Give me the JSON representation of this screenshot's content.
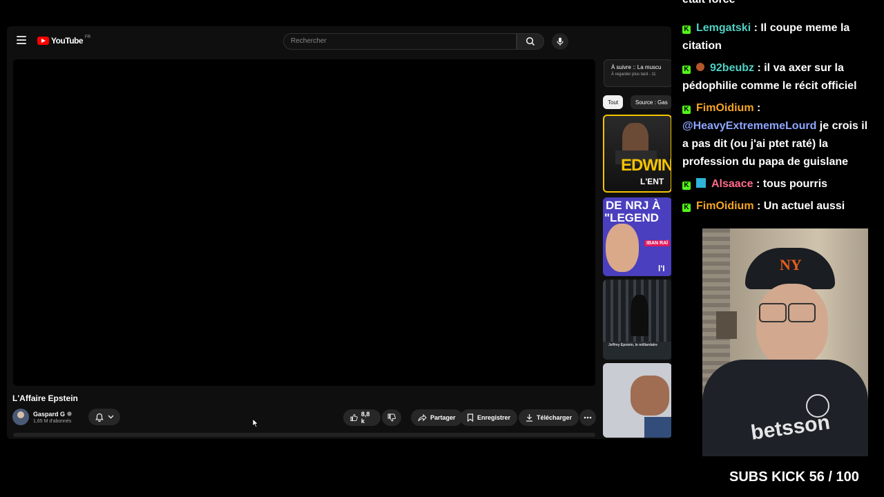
{
  "youtube": {
    "logo_text": "YouTube",
    "country_code": "FR",
    "search_placeholder": "Rechercher",
    "video_title": "L'Affaire Epstein",
    "channel_name": "Gaspard G",
    "channel_subs": "1,65 M d'abonnés",
    "likes": "8,8 k",
    "share_label": "Partager",
    "save_label": "Enregistrer",
    "download_label": "Télécharger",
    "up_next_title": "À suivre :: La muscu",
    "up_next_sub": "À regarder plus tard - 11",
    "chips": [
      "Tout",
      "Source : Gas"
    ],
    "thumb1_text": "EDWIN",
    "thumb1_sub": "L'ENT",
    "thumb2_line1": "DE NRJ À",
    "thumb2_line2": "\"LEGEND",
    "thumb2_badge": "IBAN RAÏ",
    "thumb2_corner": "l'I",
    "thumb3_caption": "Jeffrey Epstein, le milliardaire"
  },
  "chat": {
    "top_fragment": "était forcé",
    "messages": [
      {
        "user": "Lemgatski",
        "user_color": "#4fd1c5",
        "sep": " : ",
        "text": "Il coupe meme la citation"
      },
      {
        "user": "92beubz",
        "user_color": "#4fd1c5",
        "sep": " : ",
        "text": "il va axer sur la pédophilie comme le récit officiel"
      },
      {
        "user": "FimOidium",
        "user_color": "#f5a623",
        "sep": " : ",
        "mention": "@HeavyExtrememeLourd",
        "text": " je crois il a pas dit (ou j'ai ptet raté) la profession du papa de guislane"
      },
      {
        "user": "Alsaace",
        "user_color": "#ff6b8a",
        "sep": " : ",
        "text": "tous pourris"
      },
      {
        "user": "FimOidium",
        "user_color": "#f5a623",
        "sep": " : ",
        "text": "Un actuel aussi"
      }
    ]
  },
  "webcam": {
    "shirt_text": "betsson"
  },
  "overlay": {
    "subs_goal": "SUBS KICK 56 / 100"
  },
  "colors": {
    "kick_green": "#53fc18",
    "youtube_red": "#ff0000",
    "mention": "#8ea6ff"
  }
}
